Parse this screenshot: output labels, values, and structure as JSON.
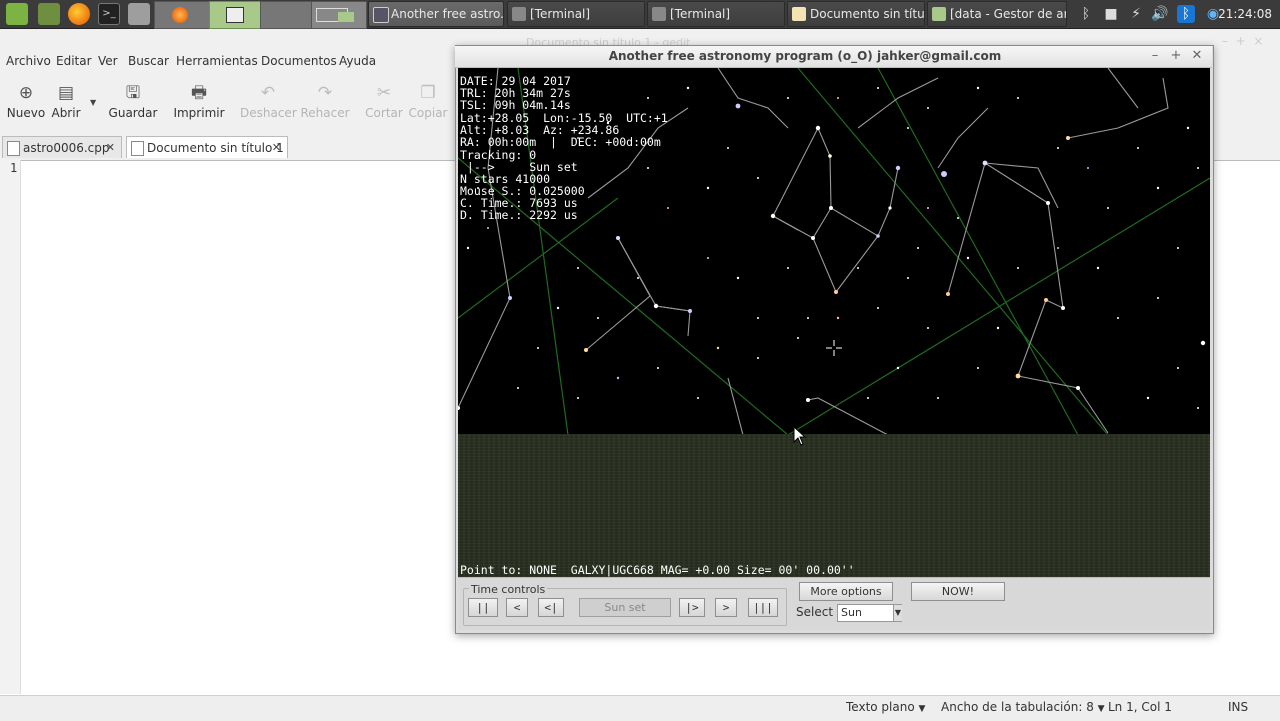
{
  "taskbar": {
    "tasks": [
      {
        "label": "Another free astro...",
        "active": true
      },
      {
        "label": "[Terminal]"
      },
      {
        "label": "[Terminal]"
      },
      {
        "label": "Documento sin títul..."
      },
      {
        "label": "[data - Gestor de ar..."
      }
    ],
    "clock": "21:24:08"
  },
  "gedit": {
    "ghost_title": "Documento sin título 1 - gedit",
    "menu": [
      "Archivo",
      "Editar",
      "Ver",
      "Buscar",
      "Herramientas",
      "Documentos",
      "Ayuda"
    ],
    "toolbar": {
      "new": "Nuevo",
      "open": "Abrir",
      "save": "Guardar",
      "print": "Imprimir",
      "undo": "Deshacer",
      "redo": "Rehacer",
      "cut": "Cortar",
      "copy": "Copiar"
    },
    "tabs": [
      "astro0006.cpp",
      "Documento sin título 1"
    ],
    "line_number": "1",
    "status": {
      "mode": "Texto plano",
      "tab_width": "Ancho de la tabulación: 8",
      "position": "Ln 1, Col 1",
      "ins": "INS"
    }
  },
  "astro": {
    "title": "Another free astronomy program  (o_O)  jahker@gmail.com",
    "hud": [
      "DATE: 29 04 2017",
      "TRL: 20h 34m 27s",
      "TSL: 09h 04m 14s",
      "Lat:+28.05  Lon:-15.50  UTC:+1",
      "Alt: +8.03  Az: +234.86",
      "RA: 00h:00m  |  DEC: +00d:00m",
      "Tracking: 0",
      " |-->     Sun set",
      "N stars 41000",
      "Mouse S.: 0.025000",
      "C. Time.: 7693 us",
      "D. Time.: 2292 us"
    ],
    "point_to": "Point to: NONE  GALXY|UGC668 MAG= +0.00 Size= 00' 00.00''",
    "controls": {
      "group_label": "Time controls",
      "pause": "||",
      "back": "<",
      "step_back": "<|",
      "state": "Sun set",
      "step_fwd": "|>",
      "fwd": ">",
      "stop": "|||",
      "more_options": "More options",
      "now": "NOW!",
      "select_label": "Select",
      "select_value": "Sun"
    }
  }
}
